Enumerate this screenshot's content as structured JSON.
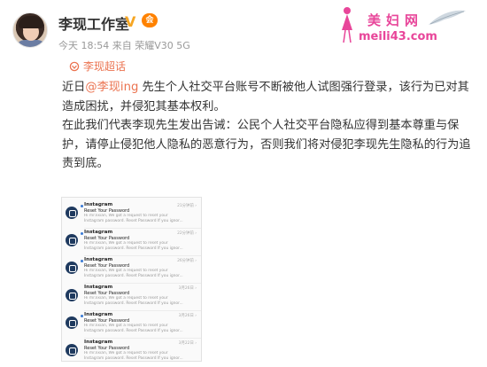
{
  "header": {
    "name": "李现工作室",
    "verified_symbol": "V",
    "vip_symbol": "会",
    "meta": "今天 18:54 来自 荣耀V30 5G"
  },
  "watermark": {
    "title": "美妇网",
    "url": "meili43.com"
  },
  "tag": {
    "label": "李现超话",
    "icon": "super-topic-icon",
    "color": "#eb7350"
  },
  "post": {
    "intro": "近日",
    "mention": "@李现ing",
    "p1_rest": " 先生个人社交平台账号不断被他人试图强行登录，该行为已对其造成困扰，并侵犯其基本权利。",
    "p2": "在此我们代表李现先生发出告诫：公民个人社交平台隐私应得到基本尊重与保护，请停止侵犯他人隐私的恶意行为，否则我们将对侵犯李现先生隐私的行为追责到底。"
  },
  "screenshot": {
    "notifications": [
      {
        "sender": "Instagram",
        "subject": "Reset Your Password",
        "preview1": "Hi mr.lixian, We got a request to reset your",
        "preview2": "Instagram password. Reset Password If you ignor...",
        "time": "21分钟前 ›",
        "unread": true
      },
      {
        "sender": "Instagram",
        "subject": "Reset Your Password",
        "preview1": "Hi mr.lixian, We got a request to reset your",
        "preview2": "Instagram password. Reset Password If you ignor...",
        "time": "22分钟前 ›",
        "unread": true
      },
      {
        "sender": "Instagram",
        "subject": "Reset Your Password",
        "preview1": "Hi mr.lixian, We got a request to reset your",
        "preview2": "Instagram password. Reset Password If you ignor...",
        "time": "26分钟前 ›",
        "unread": true
      },
      {
        "sender": "Instagram",
        "subject": "Reset Your Password",
        "preview1": "Hi mr.lixian, We got a request to reset your",
        "preview2": "Instagram password. Reset Password If you ignor...",
        "time": "3月26日 ›",
        "unread": false
      },
      {
        "sender": "Instagram",
        "subject": "Reset Your Password",
        "preview1": "Hi mr.lixian, We got a request to reset your",
        "preview2": "Instagram password. Reset Password If you ignor...",
        "time": "3月26日 ›",
        "unread": true
      },
      {
        "sender": "Instagram",
        "subject": "Reset Your Password",
        "preview1": "Hi mr.lixian, We got a request to reset your",
        "preview2": "Instagram password. Reset Password If you ignor...",
        "time": "3月22日 ›",
        "unread": false
      }
    ]
  }
}
